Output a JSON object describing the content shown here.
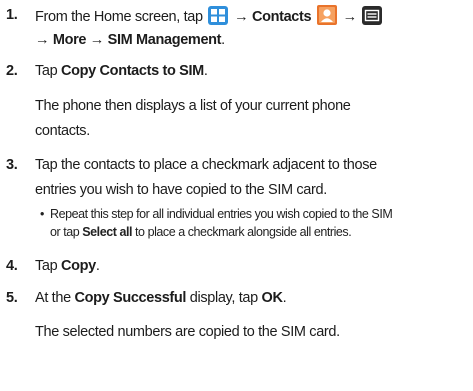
{
  "steps": [
    {
      "num": "1.",
      "l1a": "From the Home screen, tap",
      "arrow1": "→",
      "contacts": "Contacts",
      "arrow2": "→",
      "l2_arrow1": "→",
      "more": "More",
      "l2_arrow2": "→",
      "sim_mgmt": "SIM Management",
      "l2_end": "."
    },
    {
      "num": "2.",
      "tap": "Tap",
      "copy_contacts": "Copy Contacts to SIM",
      "end": ".",
      "para": [
        "The phone then displays a list of your current phone",
        "contacts."
      ]
    },
    {
      "num": "3.",
      "lines": [
        "Tap the contacts to place a checkmark adjacent to those",
        "entries you wish to have copied to the SIM card."
      ],
      "bullet": {
        "dot": "•",
        "l1": "Repeat this step for all individual entries you wish copied to the SIM",
        "l2a": "or tap",
        "select_all": "Select all",
        "l2b": "to place a checkmark alongside all entries."
      }
    },
    {
      "num": "4.",
      "tap": "Tap",
      "copy": "Copy",
      "end": "."
    },
    {
      "num": "5.",
      "pre": "At the",
      "copy_successful": "Copy Successful",
      "mid": "display, tap",
      "ok": "OK",
      "end": ".",
      "para": "The selected numbers are copied to the SIM card."
    }
  ],
  "icons": {
    "apps": "apps-grid-icon",
    "contacts": "contacts-person-icon",
    "menu": "menu-icon",
    "apps_color": "#2f8fdb",
    "contacts_color": "#e9732b",
    "menu_color": "#2b2b2b"
  }
}
